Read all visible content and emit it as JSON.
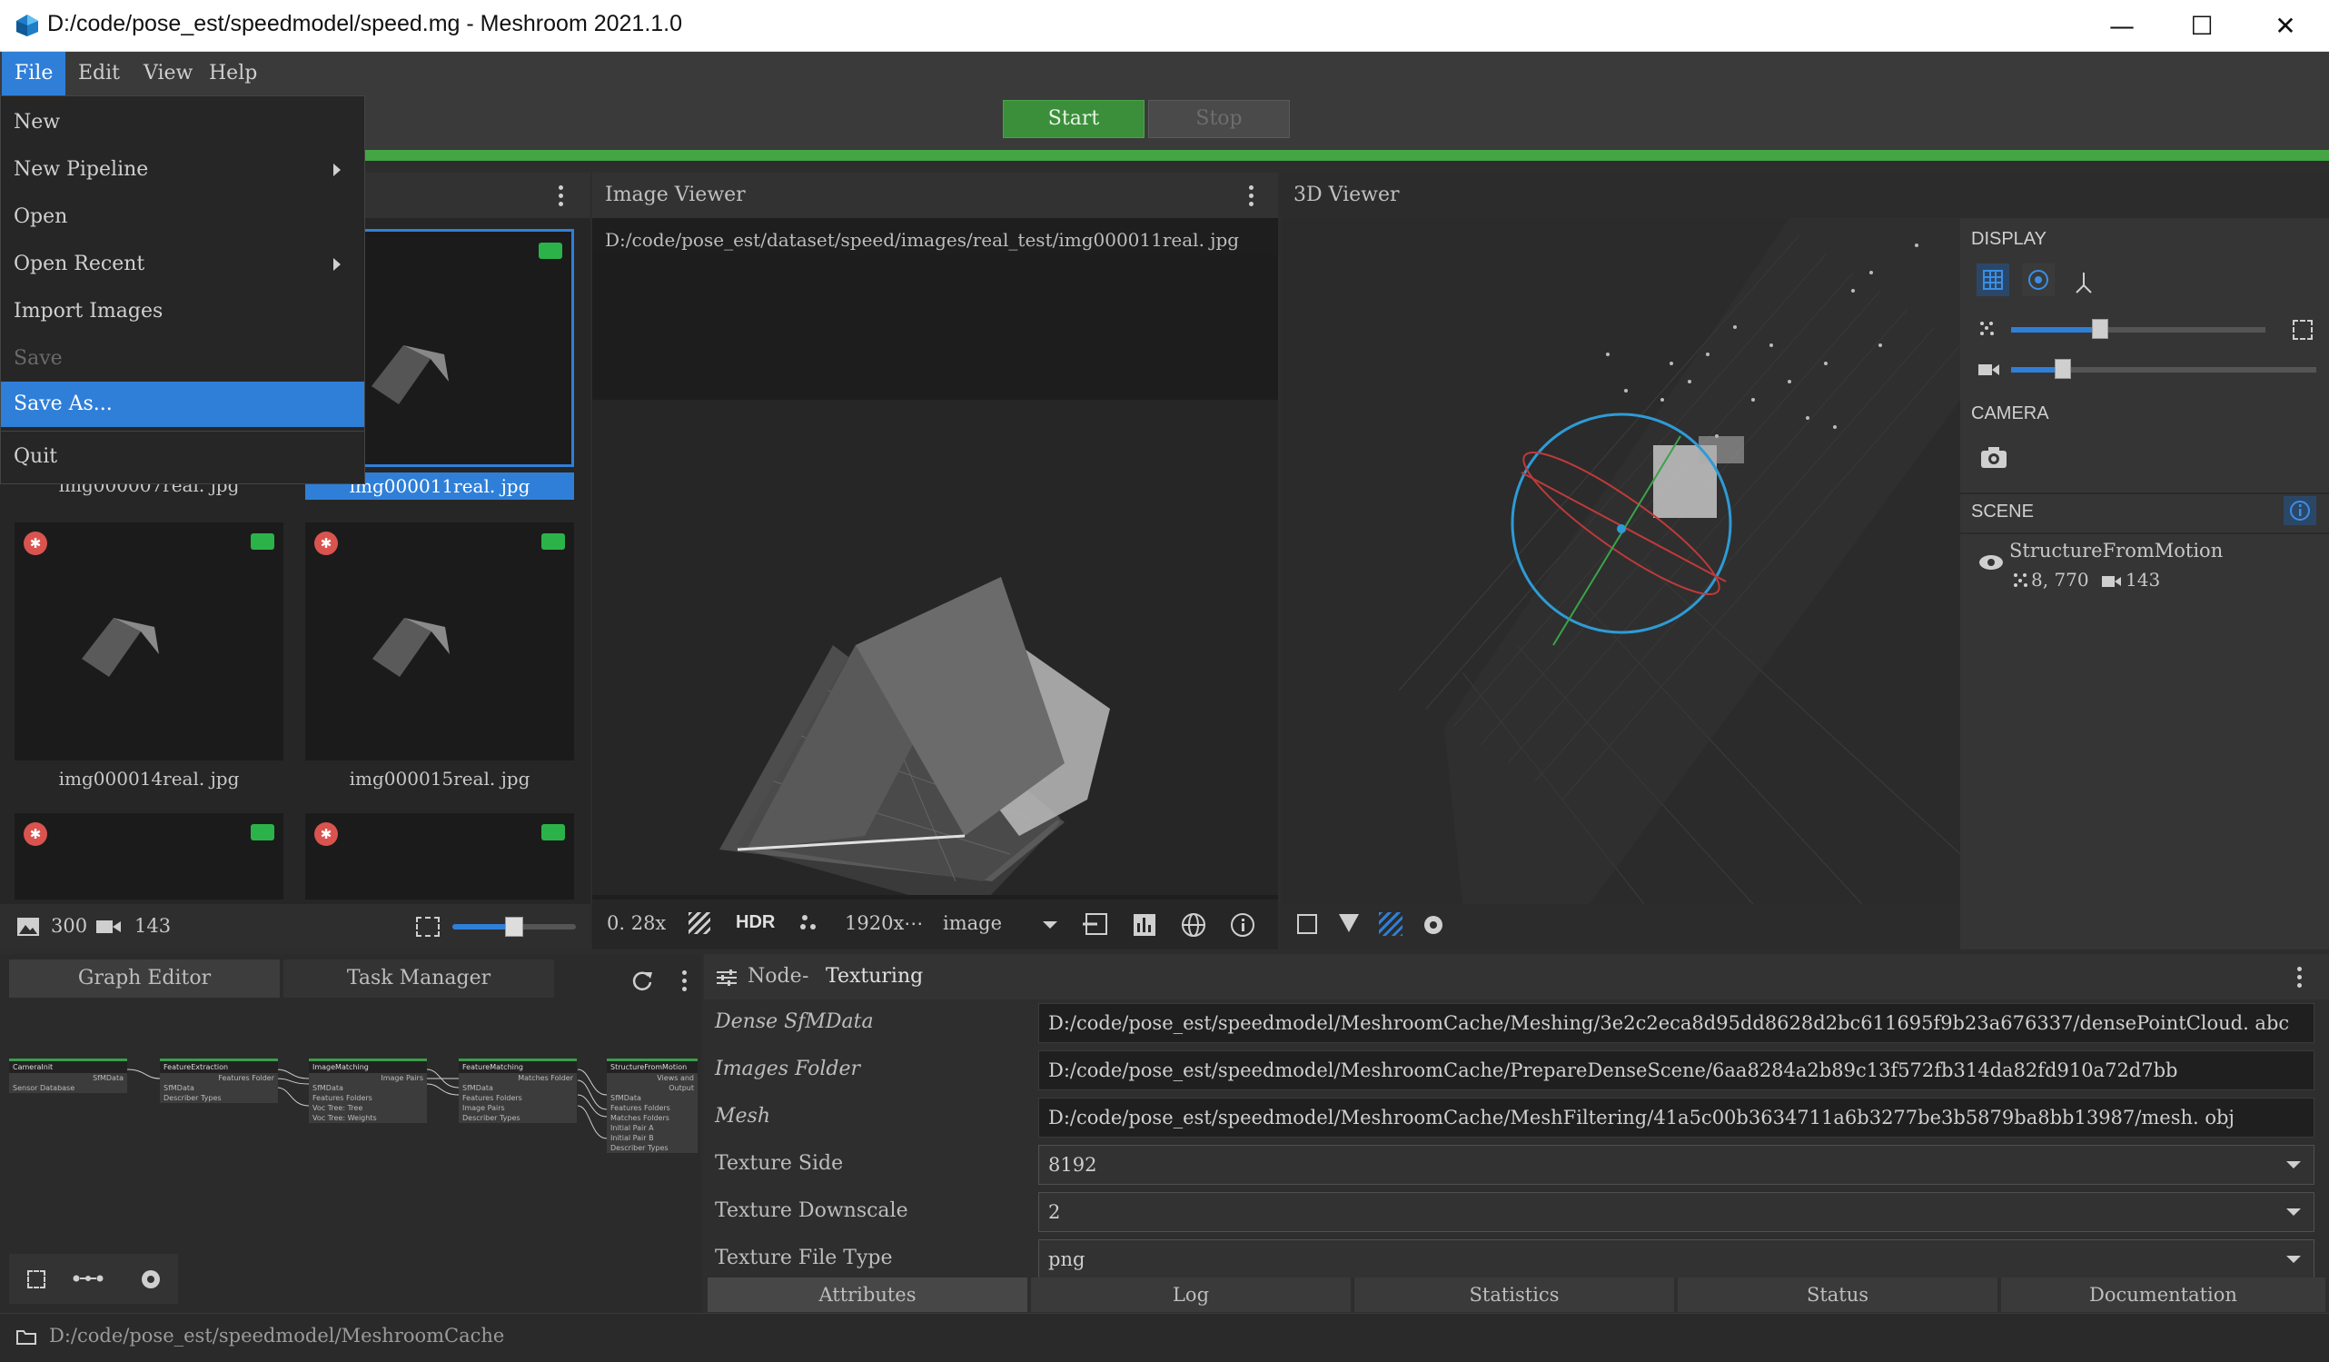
{
  "window": {
    "title": "D:/code/pose_est/speedmodel/speed.mg - Meshroom 2021.1.0",
    "minimize": "—",
    "maximize": "☐",
    "close": "✕"
  },
  "menubar": {
    "items": [
      "File",
      "Edit",
      "View",
      "Help"
    ]
  },
  "file_menu": {
    "items": [
      {
        "label": "New",
        "state": "normal"
      },
      {
        "label": "New Pipeline",
        "state": "submenu"
      },
      {
        "label": "Open",
        "state": "normal"
      },
      {
        "label": "Open Recent",
        "state": "submenu"
      },
      {
        "label": "Import Images",
        "state": "normal"
      },
      {
        "label": "Save",
        "state": "disabled"
      },
      {
        "label": "Save As...",
        "state": "highlighted"
      },
      {
        "label": "Quit",
        "state": "normal"
      }
    ]
  },
  "toolbar": {
    "start_label": "Start",
    "stop_label": "Stop",
    "progress": 1.0
  },
  "gallery": {
    "thumbnails": [
      {
        "label": "img000007real. jpg",
        "selected": false
      },
      {
        "label": "img000011real. jpg",
        "selected": true
      },
      {
        "label": "img000014real. jpg",
        "selected": false
      },
      {
        "label": "img000015real. jpg",
        "selected": false
      },
      {
        "label": "",
        "selected": false
      },
      {
        "label": "",
        "selected": false
      }
    ],
    "image_count": "300",
    "camera_count": "143"
  },
  "image_viewer": {
    "title": "Image Viewer",
    "path": "D:/code/pose_est/dataset/speed/images/real_test/img000011real. jpg",
    "zoom": "0. 28x",
    "hdr": "HDR",
    "resolution": "1920x⋯",
    "mode": "image"
  },
  "viewer3d": {
    "title": "3D Viewer",
    "display_label": "DISPLAY",
    "camera_label": "CAMERA",
    "scene_label": "SCENE",
    "scene_item": "StructureFromMotion",
    "points": "8, 770",
    "cameras": "143",
    "slider_points": 0.35,
    "slider_cameras": 0.17
  },
  "graph_editor": {
    "tabs": [
      "Graph Editor",
      "Task Manager"
    ],
    "nodes": [
      {
        "title": "CameraInit",
        "rows": [
          "SfMData",
          "Sensor Database"
        ]
      },
      {
        "title": "FeatureExtraction",
        "rows": [
          "Features Folder",
          "SfMData",
          "Describer Types"
        ]
      },
      {
        "title": "ImageMatching",
        "rows": [
          "Image Pairs",
          "SfMData",
          "Features Folders",
          "Voc Tree: Tree",
          "Voc Tree: Weights"
        ]
      },
      {
        "title": "FeatureMatching",
        "rows": [
          "Matches Folder",
          "SfMData",
          "Features Folders",
          "Image Pairs",
          "Describer Types"
        ]
      },
      {
        "title": "StructureFromMotion",
        "rows": [
          "Views and",
          "Output",
          "SfMData",
          "Features Folders",
          "Matches Folders",
          "Initial Pair A",
          "Initial Pair B",
          "Describer Types"
        ]
      }
    ]
  },
  "node_panel": {
    "prefix": "Node",
    "separator": "-",
    "name": "Texturing",
    "attributes": [
      {
        "label": "Dense SfMData",
        "italic": true,
        "value": "D:/code/pose_est/speedmodel/MeshroomCache/Meshing/3e2c2eca8d95dd8628d2bc611695f9b23a676337/densePointCloud. abc",
        "combo": false
      },
      {
        "label": "Images Folder",
        "italic": true,
        "value": "D:/code/pose_est/speedmodel/MeshroomCache/PrepareDenseScene/6aa8284a2b89c13f572fb314da82fd910a72d7bb",
        "combo": false
      },
      {
        "label": "Mesh",
        "italic": true,
        "value": "D:/code/pose_est/speedmodel/MeshroomCache/MeshFiltering/41a5c00b3634711a6b3277be3b5879ba8bb13987/mesh. obj",
        "combo": false
      },
      {
        "label": "Texture Side",
        "italic": false,
        "value": "8192",
        "combo": true
      },
      {
        "label": "Texture Downscale",
        "italic": false,
        "value": "2",
        "combo": true
      },
      {
        "label": "Texture File Type",
        "italic": false,
        "value": "png",
        "combo": true
      }
    ],
    "bottom_tabs": [
      "Attributes",
      "Log",
      "Statistics",
      "Status",
      "Documentation"
    ]
  },
  "statusbar": {
    "path": "D:/code/pose_est/speedmodel/MeshroomCache"
  },
  "colors": {
    "accent": "#2f7fd8",
    "start": "#3b8f3b",
    "progress": "#44a544",
    "camera_badge": "#2bb34a",
    "reject_badge": "#d9534f"
  }
}
